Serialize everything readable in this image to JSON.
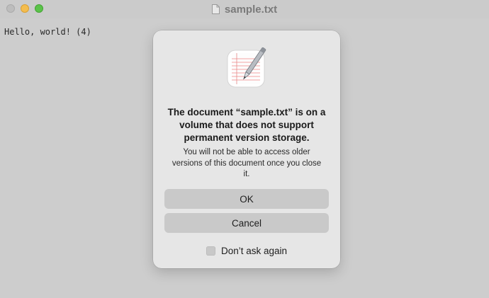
{
  "window": {
    "title": "sample.txt",
    "title_icon": "document-icon",
    "traffic_lights": [
      "close",
      "minimize",
      "zoom"
    ]
  },
  "editor": {
    "content": "Hello, world! (4)"
  },
  "dialog": {
    "icon": "textedit-app-icon",
    "title": "The document “sample.txt” is on a volume that does not support permanent version storage.",
    "message": "You will not be able to access older versions of this document once you close it.",
    "buttons": {
      "ok": "OK",
      "cancel": "Cancel"
    },
    "suppression": {
      "label": "Don’t ask again",
      "checked": false
    }
  },
  "colors": {
    "close": "#bdbdbd",
    "minimize": "#f4bd4f",
    "zoom": "#5bc34a",
    "dialog_bg": "#e6e6e6",
    "button_bg": "#c9c9c9"
  }
}
